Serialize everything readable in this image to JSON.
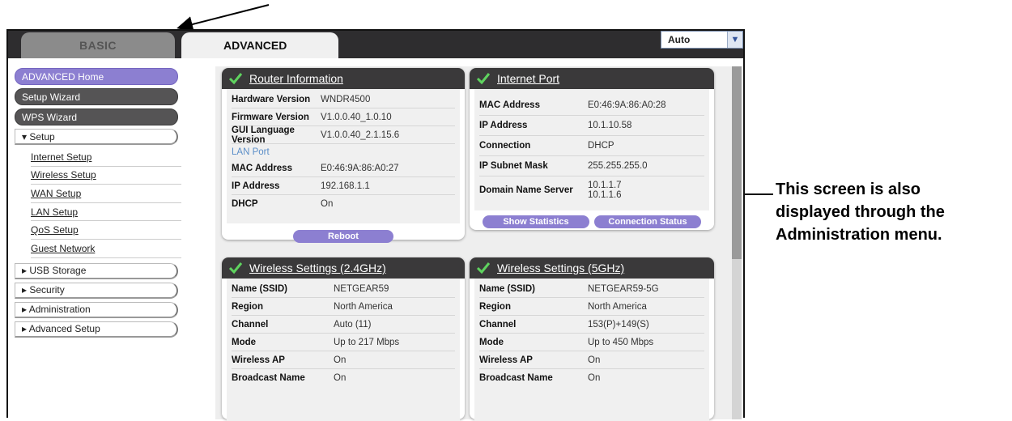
{
  "tabs": {
    "basic": "BASIC",
    "advanced": "ADVANCED"
  },
  "language_select": {
    "value": "Auto"
  },
  "menu": {
    "advanced_home": "ADVANCED Home",
    "setup_wizard": "Setup Wizard",
    "wps_wizard": "WPS Wizard",
    "setup": "▾ Setup",
    "setup_items": [
      "Internet Setup",
      "Wireless Setup",
      "WAN Setup",
      "LAN Setup",
      "QoS Setup",
      "Guest Network"
    ],
    "usb_storage": "▸ USB Storage",
    "security": "▸ Security",
    "administration": "▸ Administration",
    "advanced_setup": "▸ Advanced Setup"
  },
  "router_info": {
    "title": "Router Information",
    "rows": [
      {
        "k": "Hardware Version",
        "v": "WNDR4500"
      },
      {
        "k": "Firmware Version",
        "v": "V1.0.0.40_1.0.10"
      },
      {
        "k": "GUI Language Version",
        "v": "V1.0.0.40_2.1.15.6"
      }
    ],
    "lan_port": "LAN Port",
    "lan_rows": [
      {
        "k": "MAC Address",
        "v": "E0:46:9A:86:A0:27"
      },
      {
        "k": "IP Address",
        "v": "192.168.1.1"
      },
      {
        "k": "DHCP",
        "v": "On"
      }
    ],
    "reboot": "Reboot"
  },
  "internet_port": {
    "title": "Internet Port",
    "rows": [
      {
        "k": "MAC Address",
        "v": "E0:46:9A:86:A0:28"
      },
      {
        "k": "IP Address",
        "v": "10.1.10.58"
      },
      {
        "k": "Connection",
        "v": "DHCP"
      },
      {
        "k": "IP Subnet Mask",
        "v": "255.255.255.0"
      }
    ],
    "dns_label": "Domain Name Server",
    "dns1": "10.1.1.7",
    "dns2": "10.1.1.6",
    "show_statistics": "Show Statistics",
    "connection_status": "Connection Status"
  },
  "wireless_24": {
    "title": "Wireless Settings (2.4GHz)",
    "rows": [
      {
        "k": "Name (SSID)",
        "v": "NETGEAR59"
      },
      {
        "k": "Region",
        "v": "North America"
      },
      {
        "k": "Channel",
        "v": "Auto (11)"
      },
      {
        "k": "Mode",
        "v": "Up to 217 Mbps"
      },
      {
        "k": "Wireless AP",
        "v": "On"
      },
      {
        "k": "Broadcast Name",
        "v": "On"
      }
    ]
  },
  "wireless_5": {
    "title": "Wireless Settings (5GHz)",
    "rows": [
      {
        "k": "Name (SSID)",
        "v": "NETGEAR59-5G"
      },
      {
        "k": "Region",
        "v": "North America"
      },
      {
        "k": "Channel",
        "v": "153(P)+149(S)"
      },
      {
        "k": "Mode",
        "v": "Up to 450 Mbps"
      },
      {
        "k": "Wireless AP",
        "v": "On"
      },
      {
        "k": "Broadcast Name",
        "v": "On"
      }
    ]
  },
  "callout": {
    "line1": "This screen is also",
    "line2": "displayed through the",
    "line3": "Administration menu."
  },
  "colors": {
    "accent": "#8c7fd1",
    "header": "#3a393a",
    "check": "#5fd35f"
  }
}
